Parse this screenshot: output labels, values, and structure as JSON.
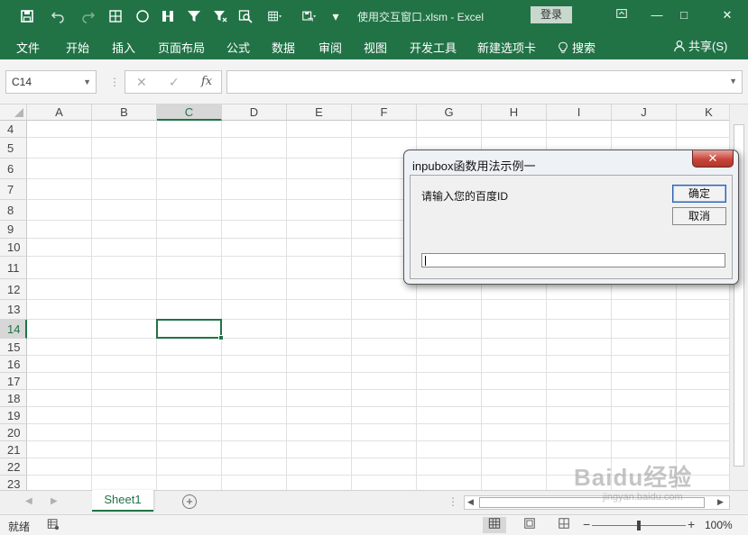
{
  "titlebar": {
    "file_title": "使用交互窗口.xlsm  -  Excel",
    "login_label": "登录",
    "minimize_glyph": "—",
    "restore_glyph": "□",
    "close_glyph": "✕",
    "customize_glyph": "▾"
  },
  "ribbon": {
    "tabs": [
      "文件",
      "开始",
      "插入",
      "页面布局",
      "公式",
      "数据",
      "审阅",
      "视图",
      "开发工具",
      "新建选项卡"
    ],
    "search_label": "搜索",
    "share_label": "共享(S)"
  },
  "formula_bar": {
    "name_box": "C14",
    "cancel_glyph": "✕",
    "enter_glyph": "✓",
    "fx_glyph": "fx",
    "formula_value": ""
  },
  "grid": {
    "columns": [
      "A",
      "B",
      "C",
      "D",
      "E",
      "F",
      "G",
      "H",
      "I",
      "J",
      "K"
    ],
    "rows": [
      "4",
      "5",
      "6",
      "7",
      "8",
      "9",
      "10",
      "11",
      "12",
      "13",
      "14",
      "15",
      "16",
      "17",
      "18",
      "19",
      "20",
      "21",
      "22",
      "23"
    ],
    "selected_column": "C",
    "selected_row": "14"
  },
  "sheets": {
    "tabs": [
      "Sheet1"
    ],
    "add_glyph": "+"
  },
  "statusbar": {
    "status_text": "就绪",
    "zoom_minus": "−",
    "zoom_plus": "+",
    "zoom_level": "100%",
    "zoom_percent": 100
  },
  "dialog": {
    "title": "inpubox函数用法示例一",
    "close_glyph": "✕",
    "prompt": "请输入您的百度ID",
    "ok_label": "确定",
    "cancel_label": "取消",
    "input_value": ""
  },
  "watermark": {
    "text": "Baidu经验",
    "sub": "jingyan.baidu.com"
  },
  "colors": {
    "excel_green": "#217346",
    "grid_line": "#e1e1e1",
    "header_bg": "#f3f3f3",
    "dialog_close": "#c9453a"
  }
}
